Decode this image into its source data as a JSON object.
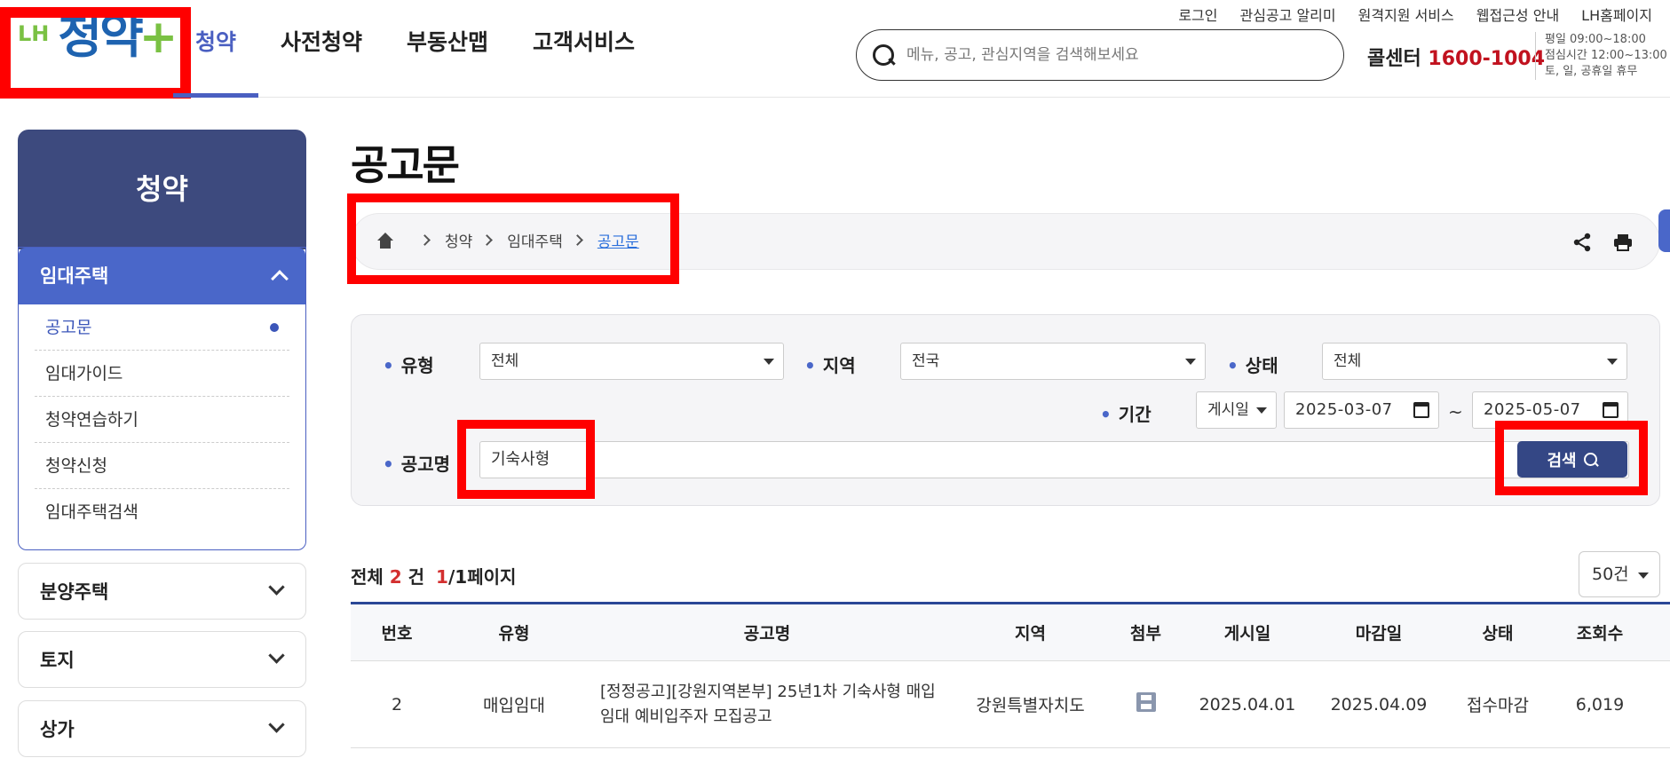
{
  "header": {
    "logo": {
      "prefix": "LH",
      "name": "청약",
      "plus": "+"
    },
    "gnb": [
      "청약",
      "사전청약",
      "부동산맵",
      "고객서비스"
    ],
    "util_links": [
      "로그인",
      "관심공고 알리미",
      "원격지원 서비스",
      "웹접근성 안내",
      "LH홈페이지"
    ],
    "search_placeholder": "메뉴, 공고, 관심지역을 검색해보세요",
    "callcenter_label": "콜센터",
    "callcenter_number": "1600-1004",
    "hours": [
      "평일 09:00~18:00",
      "점심시간 12:00~13:00",
      "토, 일, 공휴일 휴무"
    ]
  },
  "sidebar": {
    "title": "청약",
    "section": "임대주택",
    "items": [
      "공고문",
      "임대가이드",
      "청약연습하기",
      "청약신청",
      "임대주택검색"
    ],
    "accordions": [
      "분양주택",
      "토지",
      "상가"
    ]
  },
  "page": {
    "title": "공고문",
    "breadcrumb": [
      "청약",
      "임대주택",
      "공고문"
    ]
  },
  "filter": {
    "type_label": "유형",
    "type_value": "전체",
    "region_label": "지역",
    "region_value": "전국",
    "status_label": "상태",
    "status_value": "전체",
    "period_label": "기간",
    "period_type": "게시일",
    "date_from": "2025-03-07",
    "date_to": "2025-05-07",
    "tilde": "~",
    "name_label": "공고명",
    "name_value": "기숙사형",
    "search_button": "검색"
  },
  "results": {
    "total_prefix": "전체",
    "total_count": "2",
    "total_unit": "건",
    "page_current": "1",
    "page_suffix": "/1페이지",
    "per_page": "50건"
  },
  "table": {
    "headers": [
      "번호",
      "유형",
      "공고명",
      "지역",
      "첨부",
      "게시일",
      "마감일",
      "상태",
      "조회수"
    ],
    "rows": [
      {
        "no": "2",
        "type": "매입임대",
        "title": "[정정공고][강원지역본부] 25년1차 기숙사형 매입임대 예비입주자 모집공고",
        "region": "강원특별자치도",
        "attach_icon": "disk-icon",
        "posted": "2025.04.01",
        "deadline": "2025.04.09",
        "status": "접수마감",
        "views": "6,019"
      }
    ]
  },
  "colors": {
    "accent": "#4a5fc1",
    "navy": "#344785",
    "highlight": "#ff0000",
    "brand_green": "#7ac143",
    "brand_blue": "#1e63b0"
  }
}
